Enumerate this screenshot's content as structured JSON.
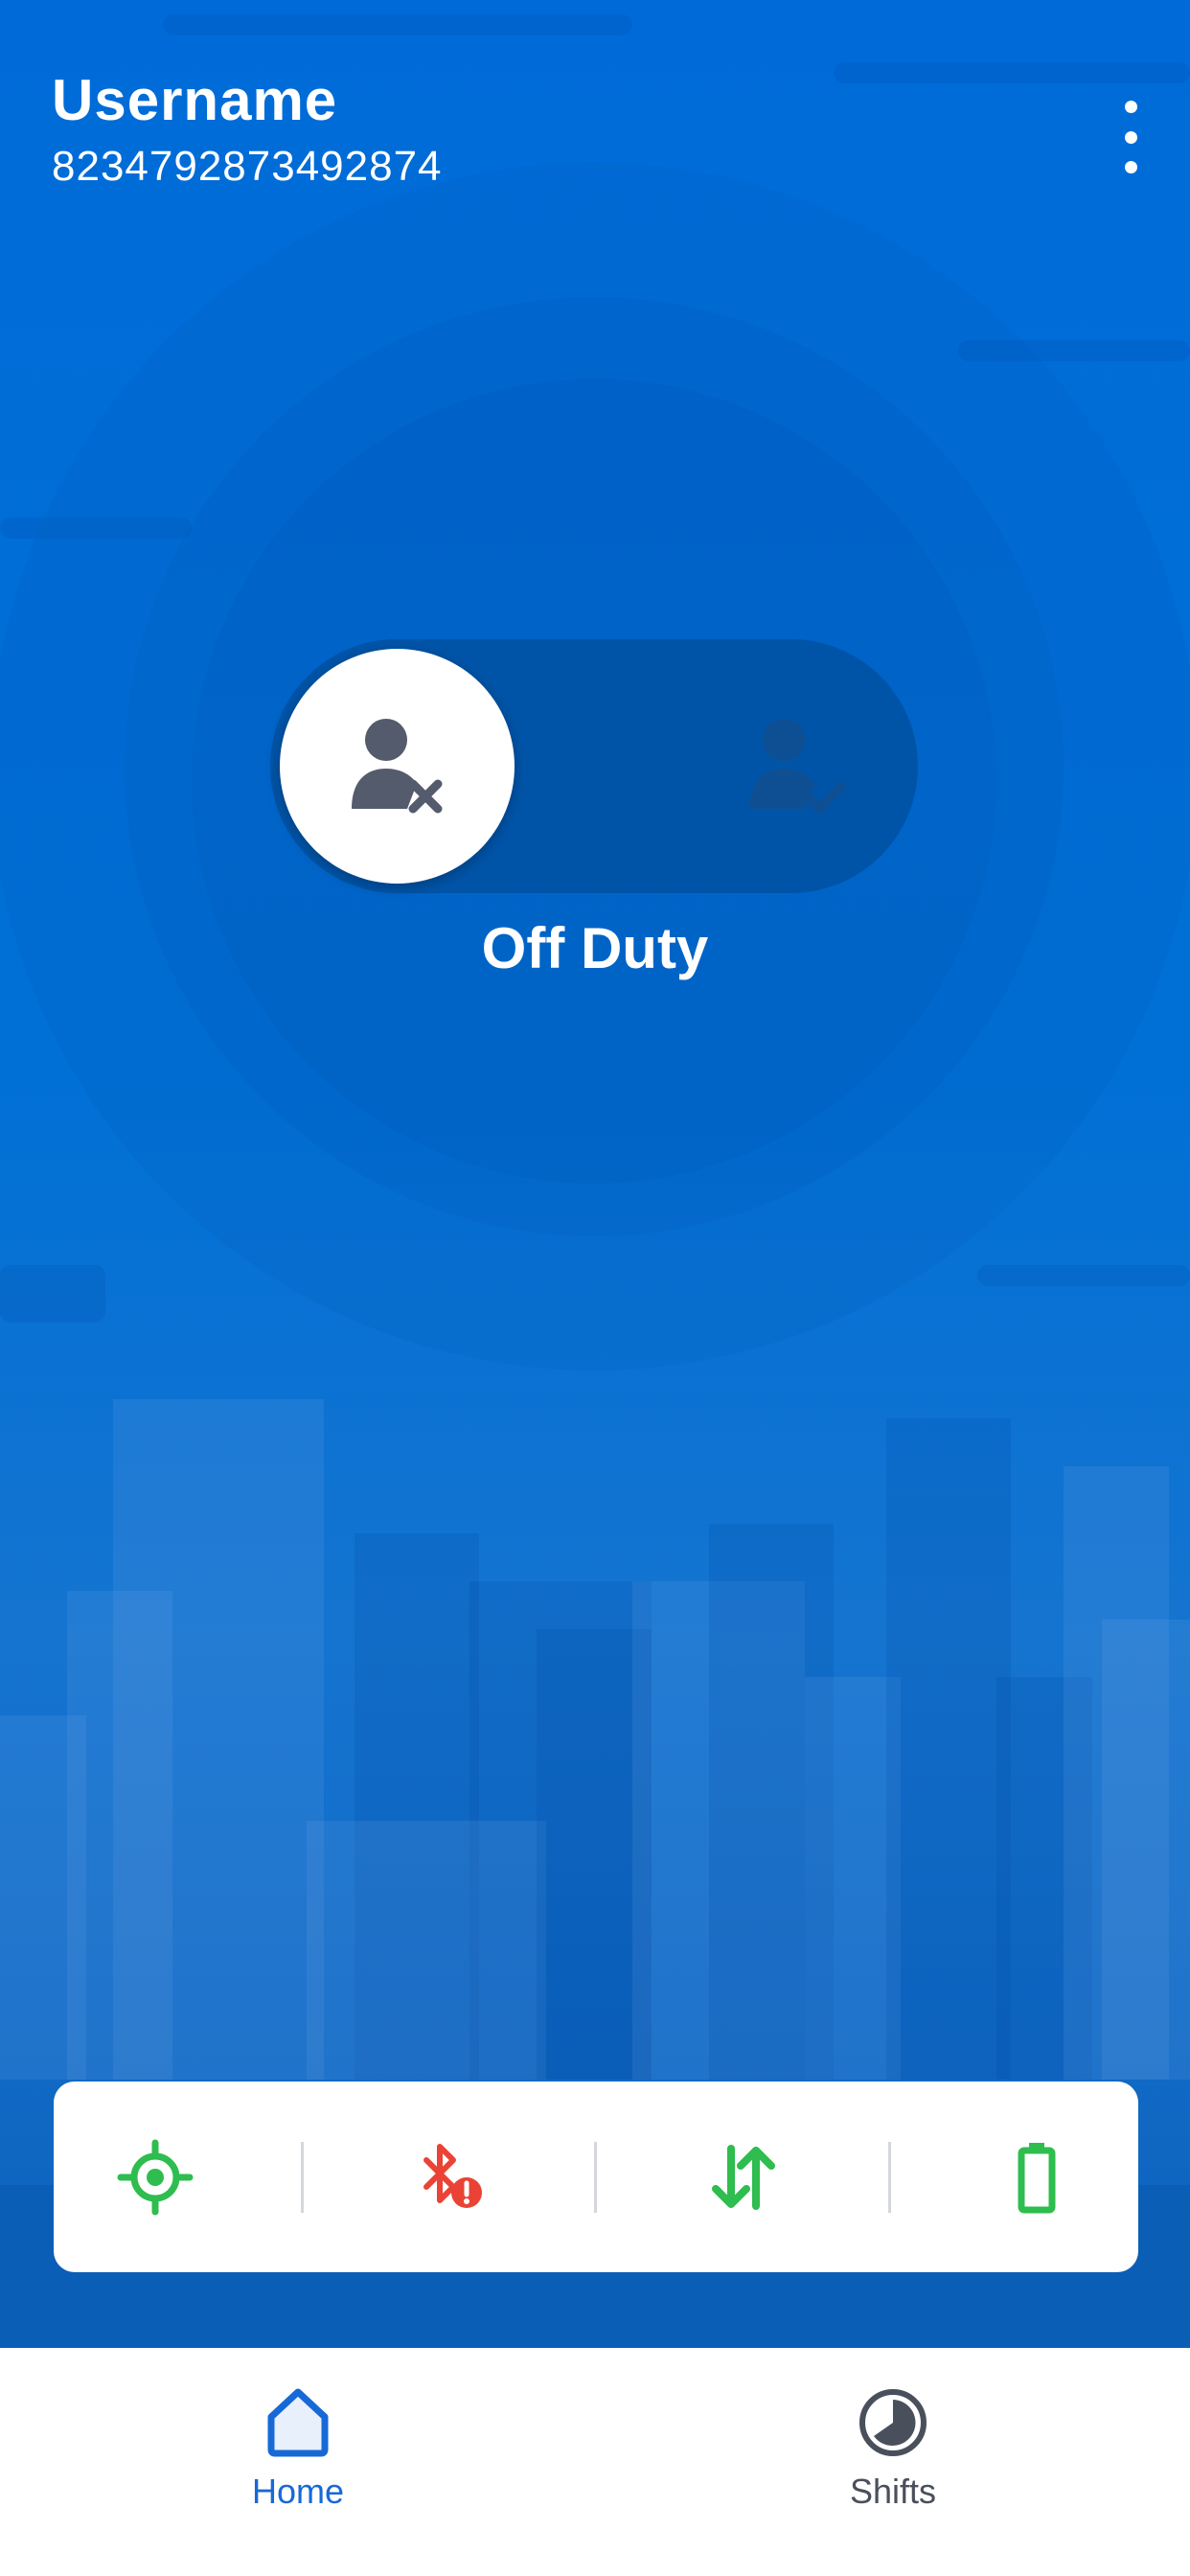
{
  "header": {
    "username": "Username",
    "user_id": "8234792873492874"
  },
  "menu": {
    "icon": "more-vert-icon"
  },
  "duty_toggle": {
    "status_label": "Off Duty",
    "state": "off",
    "off_icon": "user-x-icon",
    "on_icon": "user-check-icon"
  },
  "status_bar": {
    "items": [
      {
        "icon": "location-target-icon",
        "status": "ok",
        "color": "#2ebd4e"
      },
      {
        "icon": "bluetooth-error-icon",
        "status": "error",
        "color": "#ea4335"
      },
      {
        "icon": "data-transfer-icon",
        "status": "ok",
        "color": "#2ebd4e"
      },
      {
        "icon": "battery-icon",
        "status": "ok",
        "color": "#2ebd4e"
      }
    ]
  },
  "navbar": {
    "items": [
      {
        "label": "Home",
        "icon": "home-icon",
        "active": true
      },
      {
        "label": "Shifts",
        "icon": "clock-icon",
        "active": false
      }
    ]
  },
  "colors": {
    "primary": "#0070d6",
    "active_nav": "#1769d6",
    "ok": "#2ebd4e",
    "error": "#ea4335"
  }
}
